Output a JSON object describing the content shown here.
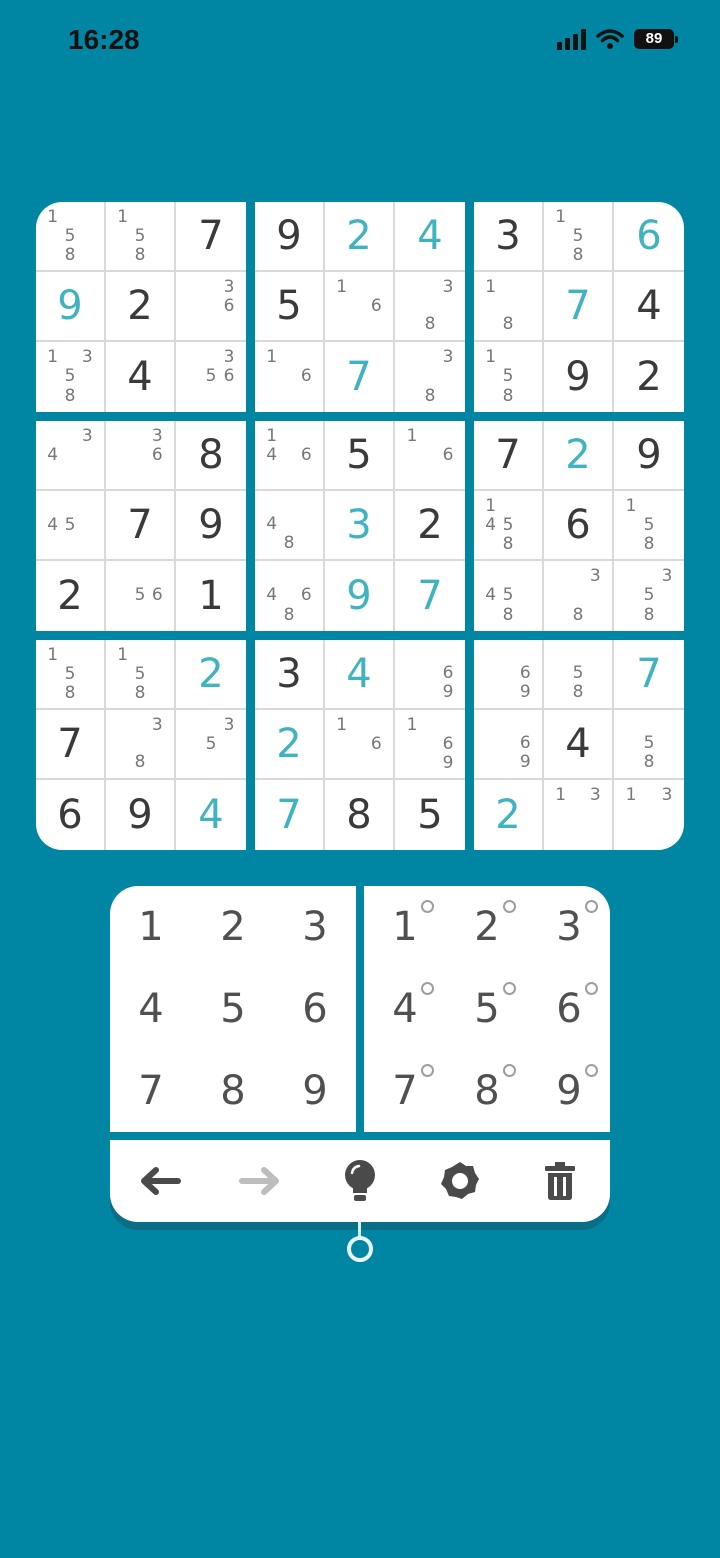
{
  "status_bar": {
    "time": "16:28",
    "battery": "89"
  },
  "colors": {
    "background": "#0085a3",
    "given_digit": "#3a3a3a",
    "user_digit": "#3fb3bf",
    "notes": "#777777"
  },
  "board": [
    [
      {
        "n": [
          1,
          5,
          8
        ]
      },
      {
        "n": [
          1,
          5,
          8
        ]
      },
      {
        "v": "7",
        "t": "g"
      },
      {
        "v": "9",
        "t": "g"
      },
      {
        "v": "2",
        "t": "u"
      },
      {
        "v": "4",
        "t": "u"
      },
      {
        "v": "3",
        "t": "g"
      },
      {
        "n": [
          1,
          5,
          8
        ]
      },
      {
        "v": "6",
        "t": "u"
      }
    ],
    [
      {
        "v": "9",
        "t": "u"
      },
      {
        "v": "2",
        "t": "g"
      },
      {
        "n": [
          3,
          6
        ]
      },
      {
        "v": "5",
        "t": "g"
      },
      {
        "n": [
          1,
          6
        ]
      },
      {
        "n": [
          3,
          8
        ]
      },
      {
        "n": [
          1,
          8
        ]
      },
      {
        "v": "7",
        "t": "u"
      },
      {
        "v": "4",
        "t": "g"
      }
    ],
    [
      {
        "n": [
          1,
          3,
          5,
          8
        ]
      },
      {
        "v": "4",
        "t": "g"
      },
      {
        "n": [
          3,
          5,
          6
        ]
      },
      {
        "n": [
          1,
          6
        ]
      },
      {
        "v": "7",
        "t": "u"
      },
      {
        "n": [
          3,
          8
        ]
      },
      {
        "n": [
          1,
          5,
          8
        ]
      },
      {
        "v": "9",
        "t": "g"
      },
      {
        "v": "2",
        "t": "g"
      }
    ],
    [
      {
        "n": [
          3,
          4
        ]
      },
      {
        "n": [
          3,
          6
        ]
      },
      {
        "v": "8",
        "t": "g"
      },
      {
        "n": [
          1,
          4,
          6
        ]
      },
      {
        "v": "5",
        "t": "g"
      },
      {
        "n": [
          1,
          6
        ]
      },
      {
        "v": "7",
        "t": "g"
      },
      {
        "v": "2",
        "t": "u"
      },
      {
        "v": "9",
        "t": "g"
      }
    ],
    [
      {
        "n": [
          4,
          5
        ]
      },
      {
        "v": "7",
        "t": "g"
      },
      {
        "v": "9",
        "t": "g"
      },
      {
        "n": [
          4,
          8
        ]
      },
      {
        "v": "3",
        "t": "u"
      },
      {
        "v": "2",
        "t": "g"
      },
      {
        "n": [
          1,
          4,
          5,
          8
        ]
      },
      {
        "v": "6",
        "t": "g"
      },
      {
        "n": [
          1,
          5,
          8
        ]
      }
    ],
    [
      {
        "v": "2",
        "t": "g"
      },
      {
        "n": [
          5,
          6
        ]
      },
      {
        "v": "1",
        "t": "g"
      },
      {
        "n": [
          4,
          6,
          8
        ]
      },
      {
        "v": "9",
        "t": "u"
      },
      {
        "v": "7",
        "t": "u"
      },
      {
        "n": [
          4,
          5,
          8
        ]
      },
      {
        "n": [
          3,
          8
        ]
      },
      {
        "n": [
          3,
          5,
          8
        ]
      }
    ],
    [
      {
        "n": [
          1,
          5,
          8
        ]
      },
      {
        "n": [
          1,
          5,
          8
        ]
      },
      {
        "v": "2",
        "t": "u"
      },
      {
        "v": "3",
        "t": "g"
      },
      {
        "v": "4",
        "t": "u"
      },
      {
        "n": [
          6,
          9
        ]
      },
      {
        "n": [
          6,
          9
        ]
      },
      {
        "n": [
          5,
          8
        ]
      },
      {
        "v": "7",
        "t": "u"
      }
    ],
    [
      {
        "v": "7",
        "t": "g"
      },
      {
        "n": [
          3,
          8
        ]
      },
      {
        "n": [
          3,
          5
        ]
      },
      {
        "v": "2",
        "t": "u"
      },
      {
        "n": [
          1,
          6
        ]
      },
      {
        "n": [
          1,
          6,
          9
        ]
      },
      {
        "n": [
          6,
          9
        ]
      },
      {
        "v": "4",
        "t": "g"
      },
      {
        "n": [
          5,
          8
        ]
      }
    ],
    [
      {
        "v": "6",
        "t": "g"
      },
      {
        "v": "9",
        "t": "g"
      },
      {
        "v": "4",
        "t": "u"
      },
      {
        "v": "7",
        "t": "u"
      },
      {
        "v": "8",
        "t": "g"
      },
      {
        "v": "5",
        "t": "g"
      },
      {
        "v": "2",
        "t": "u"
      },
      {
        "n": [
          1,
          3
        ]
      },
      {
        "n": [
          1,
          3
        ]
      }
    ]
  ],
  "number_pad": [
    "1",
    "2",
    "3",
    "4",
    "5",
    "6",
    "7",
    "8",
    "9"
  ],
  "notes_pad": [
    "1",
    "2",
    "3",
    "4",
    "5",
    "6",
    "7",
    "8",
    "9"
  ],
  "toolbar": {
    "undo_icon": "arrow-left-icon",
    "redo_icon": "arrow-right-icon",
    "hint_icon": "lightbulb-icon",
    "settings_icon": "gear-icon",
    "delete_icon": "trash-icon"
  }
}
